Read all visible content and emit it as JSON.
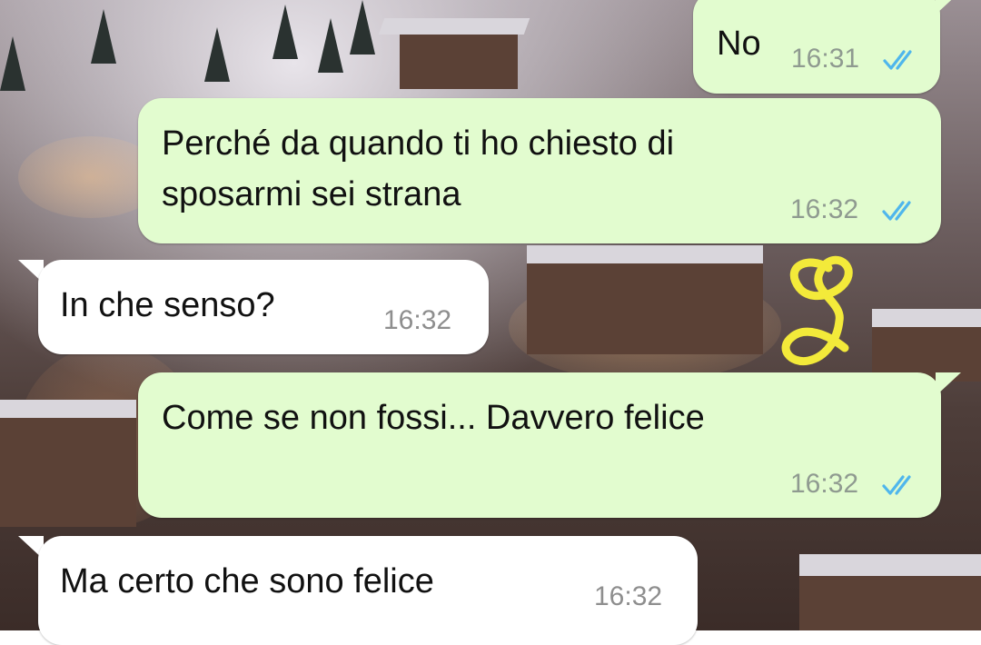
{
  "messages": [
    {
      "direction": "outgoing",
      "text": "No",
      "time": "16:31",
      "status": "read"
    },
    {
      "direction": "outgoing",
      "text_lines": [
        "Perché da quando ti ho chiesto di",
        "sposarmi sei strana"
      ],
      "time": "16:32",
      "status": "read"
    },
    {
      "direction": "incoming",
      "text": "In che senso?",
      "time": "16:32"
    },
    {
      "direction": "outgoing",
      "text": "Come se non fossi... Davvero felice",
      "time": "16:32",
      "status": "read"
    },
    {
      "direction": "incoming",
      "text": "Ma certo che sono felice",
      "time": "16:32"
    }
  ],
  "icons": {
    "read_receipt": "double-check-icon",
    "annotation": "handdrawn-figure-eight-icon"
  },
  "colors": {
    "outgoing_bubble": "#e2fccf",
    "incoming_bubble": "#ffffff",
    "read_ticks": "#4fb6ec",
    "annotation": "#f3ea3a"
  }
}
